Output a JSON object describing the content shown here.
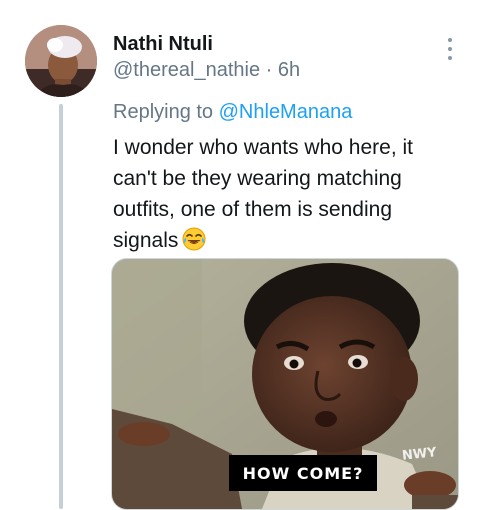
{
  "tweet": {
    "author_name": "Nathi Ntuli",
    "handle": "@thereal_nathie",
    "time": "6h",
    "meta_separator": " · ",
    "replying_prefix": "Replying to ",
    "replying_to": "@NhleManana",
    "body_lines": [
      "I wonder who wants who here, it",
      "can't be they wearing matching",
      "outfits, one of them is sending",
      "signals"
    ],
    "emoji": "face-with-tears-of-joy-icon",
    "media": {
      "caption": "HOW COME?",
      "watermark": "NWY"
    }
  },
  "colors": {
    "text_primary": "#14171a",
    "text_secondary": "#657786",
    "link": "#1da1f2",
    "thread_line": "#c4cfd6"
  }
}
